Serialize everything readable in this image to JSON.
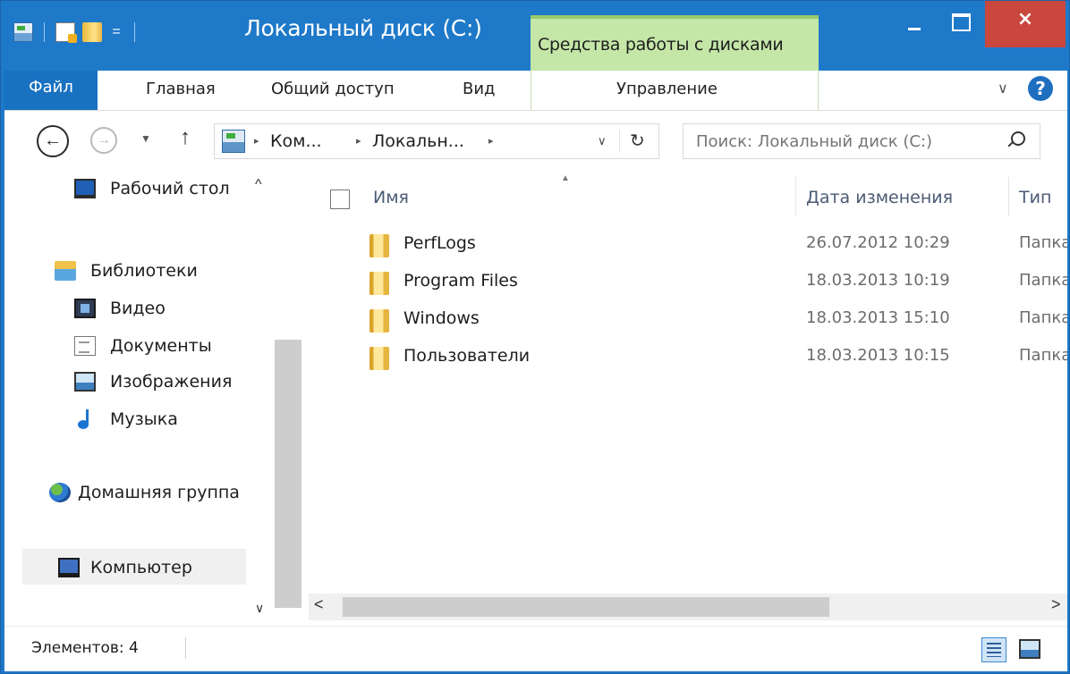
{
  "window": {
    "title": "Локальный диск (C:)",
    "contextual_tab_group": "Средства работы с дисками",
    "close_glyph": "×",
    "accent_color": "#1e79c9",
    "close_color": "#c9473d",
    "contextual_color": "#c4e7a8"
  },
  "quick_access": {
    "customize_glyph": "="
  },
  "ribbon": {
    "file_tab": "Файл",
    "tabs": [
      "Главная",
      "Общий доступ",
      "Вид",
      "Управление"
    ],
    "expand_glyph": "∨",
    "help_glyph": "?"
  },
  "address_bar": {
    "back_glyph": "←",
    "forward_glyph": "→",
    "recent_glyph": "▼",
    "up_glyph": "↑",
    "breadcrumbs": [
      "Ком...",
      "Локальн..."
    ],
    "crumb_separator": "▸",
    "dropdown_glyph": "∨",
    "refresh_glyph": "↻"
  },
  "search": {
    "placeholder": "Поиск: Локальный диск (C:)"
  },
  "nav_pane": {
    "items": [
      {
        "label": "Рабочий стол",
        "icon": "desktop-icon"
      },
      {
        "label": "Библиотеки",
        "icon": "libraries-icon"
      },
      {
        "label": "Видео",
        "icon": "video-icon"
      },
      {
        "label": "Документы",
        "icon": "documents-icon"
      },
      {
        "label": "Изображения",
        "icon": "pictures-icon"
      },
      {
        "label": "Музыка",
        "icon": "music-icon"
      },
      {
        "label": "Домашняя группа",
        "icon": "homegroup-icon"
      },
      {
        "label": "Компьютер",
        "icon": "computer-icon"
      }
    ],
    "scroll_up_glyph": "^",
    "scroll_down_glyph": "∨"
  },
  "content": {
    "sort_glyph": "▲",
    "columns": {
      "name": "Имя",
      "date": "Дата изменения",
      "type": "Тип"
    },
    "rows": [
      {
        "name": "PerfLogs",
        "date": "26.07.2012 10:29",
        "type": "Папка с файлами"
      },
      {
        "name": "Program Files",
        "date": "18.03.2013 10:19",
        "type": "Папка с файлами"
      },
      {
        "name": "Windows",
        "date": "18.03.2013 15:10",
        "type": "Папка с файлами"
      },
      {
        "name": "Пользователи",
        "date": "18.03.2013 10:15",
        "type": "Папка с файлами"
      }
    ],
    "hscroll_left_glyph": "<",
    "hscroll_right_glyph": ">"
  },
  "status_bar": {
    "items_count": "Элементов: 4"
  }
}
